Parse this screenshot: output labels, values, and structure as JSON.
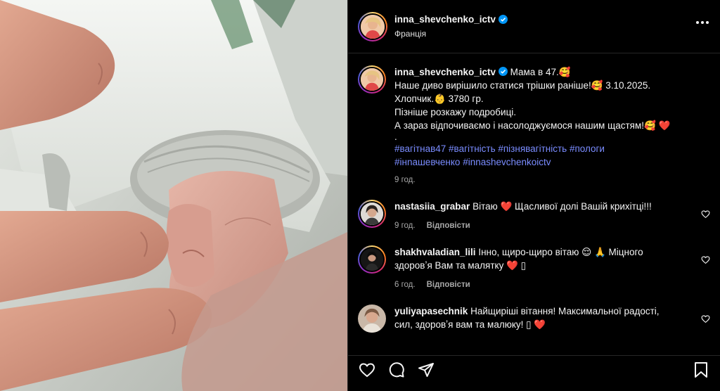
{
  "post": {
    "author": "inna_shevchenko_ictv",
    "location": "Франція",
    "caption": {
      "author": "inna_shevchenko_ictv",
      "lines": [
        "Мама в 47.🥰",
        "Наше диво вирішило статися трішки раніше!🥰  3.10.2025.",
        "Хлопчик.👶  3780 гр.",
        "Пізніше розкажу подробиці.",
        "А зараз відпочиваємо і насолоджуємося нашим щастям!🥰 ❤️",
        "."
      ],
      "hashtags_line1": "#вагітнав47 #вагітність #пізнявагітність #пологи",
      "hashtags_line2": "#інnашевченко #innashevchenkoictv",
      "time": "9 год."
    }
  },
  "comments": [
    {
      "user": "nastasiia_grabar",
      "text": "Вітаю  ❤️  Щасливої долі Вашій крихітці!!!",
      "text_cont": "",
      "time": "9 год.",
      "reply": "Відповісти"
    },
    {
      "user": "shakhvaladian_lili",
      "text": "Інно, щиро-щиро вітаю 😌 🙏 Міцного",
      "text_cont": "здоровʼя Вам та малятку ❤️ ▯",
      "time": "6 год.",
      "reply": "Відповісти"
    },
    {
      "user": "yuliyapasechnik",
      "text": "Найщиріші вітання! Максимальної радості,",
      "text_cont": "сил, здоровʼя вам та малюку! ▯ ❤️",
      "time": "",
      "reply": ""
    }
  ],
  "icons": {
    "verified": "verified-badge-icon",
    "more": "more-options-icon",
    "like": "heart-icon",
    "comment": "comment-icon",
    "share": "share-icon",
    "save": "bookmark-icon"
  },
  "colors": {
    "background": "#000000",
    "hashtag": "#7a8cff",
    "verified": "#0095f6",
    "muted": "#a8a8a8"
  }
}
